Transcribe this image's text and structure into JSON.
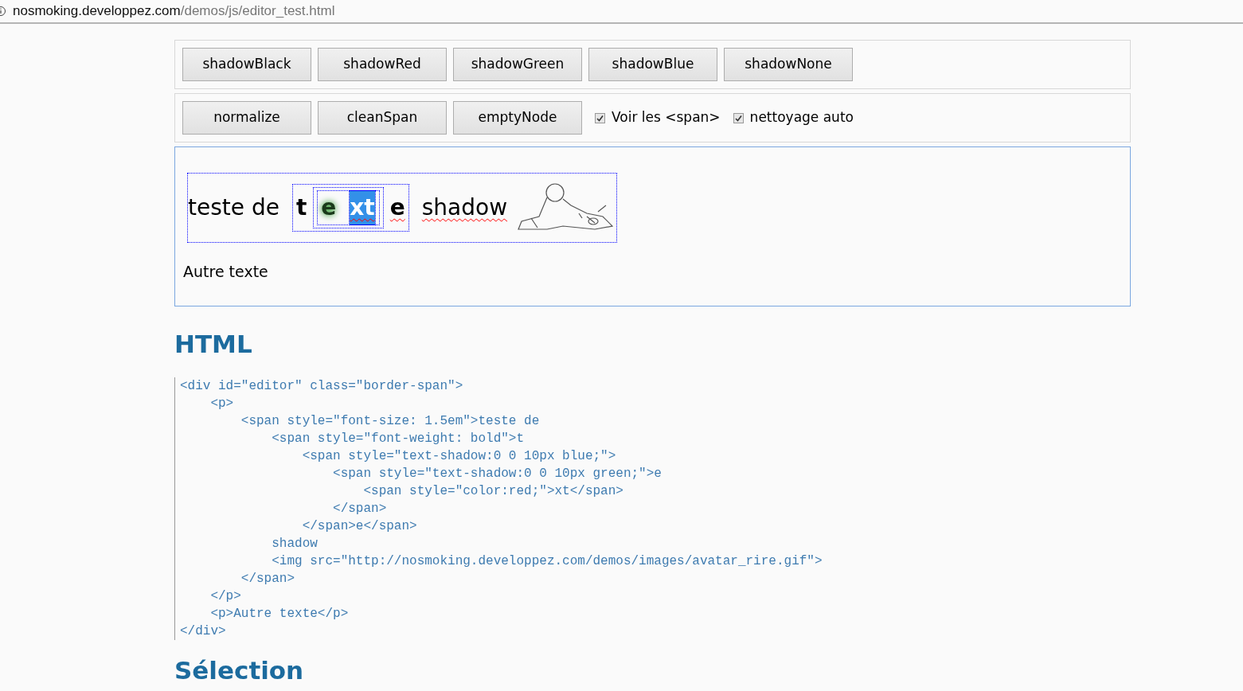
{
  "address_bar": {
    "host": "nosmoking.developpez.com",
    "path": "/demos/js/editor_test.html"
  },
  "toolbar_1": {
    "buttons": [
      "shadowBlack",
      "shadowRed",
      "shadowGreen",
      "shadowBlue",
      "shadowNone"
    ]
  },
  "toolbar_2": {
    "buttons": [
      "normalize",
      "cleanSpan",
      "emptyNode"
    ],
    "checkboxes": [
      {
        "label": "Voir les <span>",
        "checked": true
      },
      {
        "label": "nettoyage auto",
        "checked": true
      }
    ]
  },
  "editor": {
    "line_1": [
      {
        "text": "teste de",
        "kind": "plain",
        "misspelled": false
      },
      {
        "text": "t",
        "kind": "bold",
        "misspelled": false
      },
      {
        "text": "e",
        "kind": "green-shadow",
        "misspelled": false
      },
      {
        "text": "xt",
        "kind": "selected",
        "misspelled": true
      },
      {
        "text": "e",
        "kind": "bold",
        "misspelled": true
      },
      {
        "text": "shadow",
        "kind": "plain",
        "misspelled": true
      }
    ],
    "line_2": "Autre texte"
  },
  "html_section": {
    "heading": "HTML",
    "code_lines": [
      "<div id=\"editor\" class=\"border-span\">",
      "    <p>",
      "        <span style=\"font-size: 1.5em\">teste de",
      "            <span style=\"font-weight: bold\">t",
      "                <span style=\"text-shadow:0 0 10px blue;\">",
      "                    <span style=\"text-shadow:0 0 10px green;\">e",
      "                        <span style=\"color:red;\">xt</span>",
      "                    </span>",
      "                </span>e</span>",
      "            shadow",
      "            <img src=\"http://nosmoking.developpez.com/demos/images/avatar_rire.gif\">",
      "        </span>",
      "    </p>",
      "    <p>Autre texte</p>",
      "</div>"
    ]
  },
  "selection_section": {
    "heading": "Sélection"
  }
}
